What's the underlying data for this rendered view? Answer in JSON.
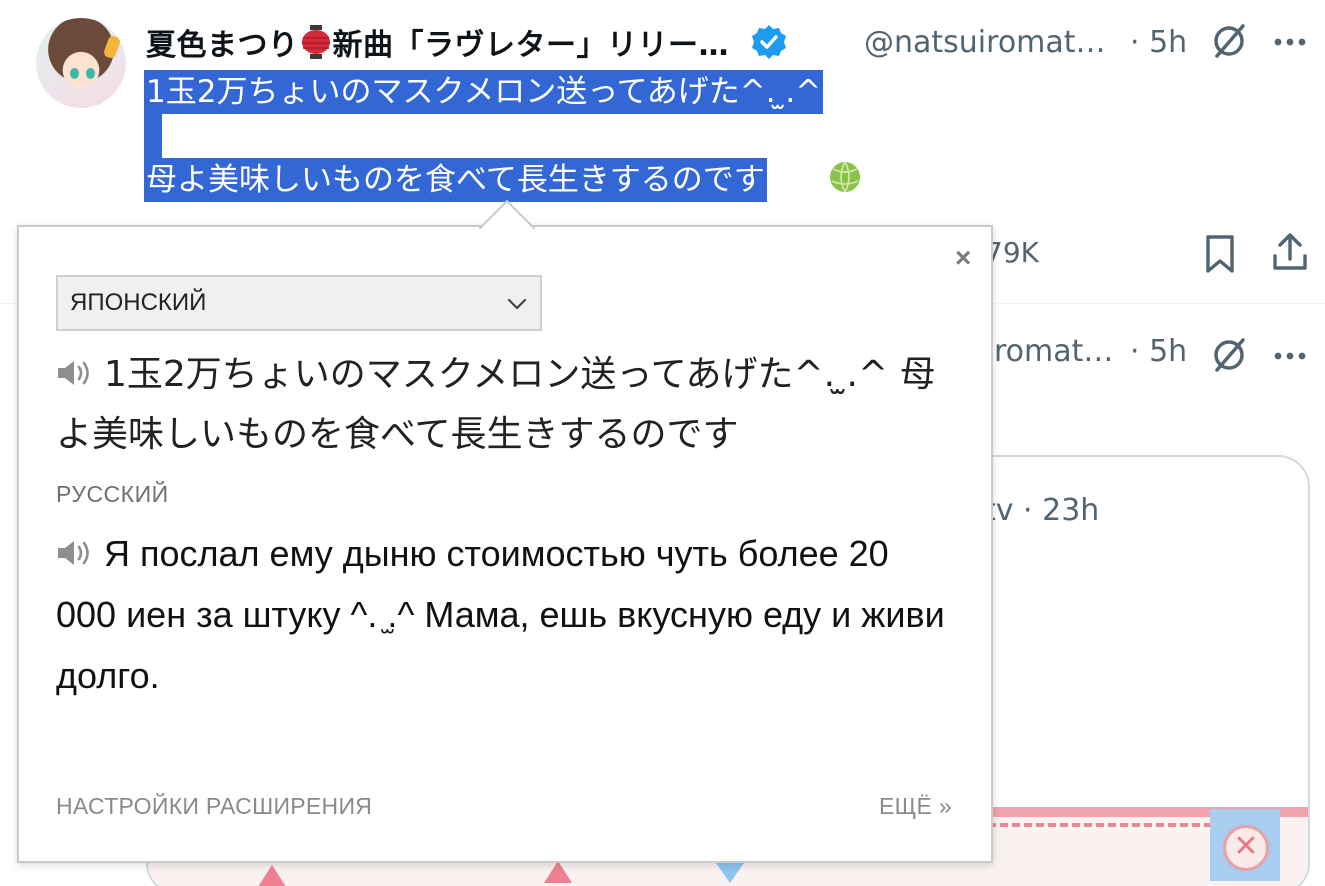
{
  "tweet1": {
    "display_name_a": "夏色まつり",
    "display_name_b": "新曲「ラヴレター」リリー…",
    "handle": "@natsuiromat…",
    "time": "· 5h",
    "text_line1": "1玉2万ちょいのマスクメロン送ってあげた^. ̫.^",
    "text_line3": "母よ美味しいものを食べて長生きするのです",
    "action_count_partial": "79K",
    "icons": [
      "lantern-emoji",
      "verified-badge-icon",
      "grok-icon",
      "more-icon",
      "melon-emoji",
      "bookmark-icon",
      "share-icon"
    ]
  },
  "tweet2": {
    "handle_partial": "romat…",
    "time": "· 5h",
    "quote_meta_partial": "tv · 23h"
  },
  "popup": {
    "source_language": "ЯПОНСКИЙ",
    "source_text": "1玉2万ちょいのマスクメロン送ってあげた^. ̫.^ 母よ美味しいものを食べて長生きするのです",
    "target_language": "РУССКИЙ",
    "translation": "Я послал ему дыню стоимостью чуть более 20 000 иен за штуку ^. ̫.^ Мама, ешь вкусную еду и живи долго.",
    "settings_link": "НАСТРОЙКИ РАСШИРЕНИЯ",
    "more_link": "ЕЩЁ »",
    "close_glyph": "×"
  },
  "colors": {
    "selection": "#3367d6",
    "verified": "#1d9bf0",
    "secondary_text": "#536471"
  }
}
